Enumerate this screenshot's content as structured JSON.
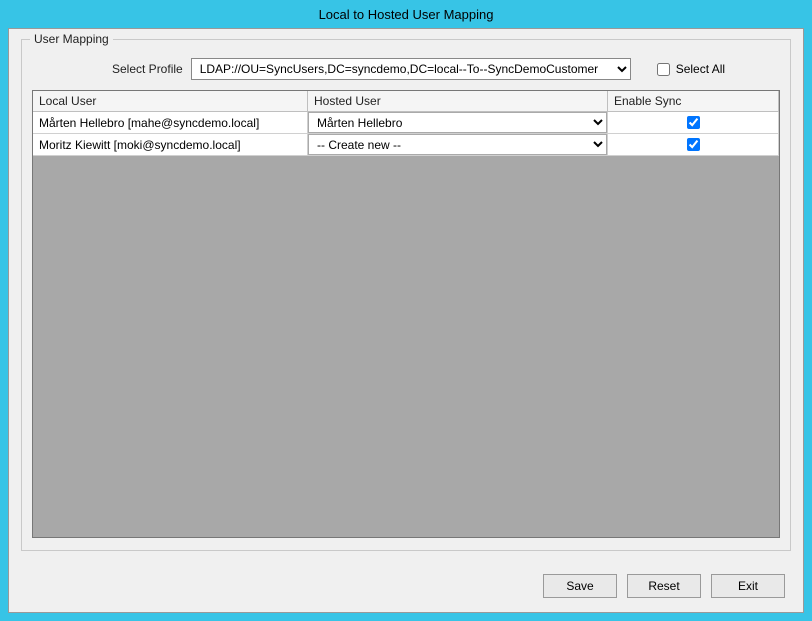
{
  "window": {
    "title": "Local to Hosted User Mapping"
  },
  "group": {
    "label": "User Mapping"
  },
  "profile": {
    "label": "Select Profile",
    "value": "LDAP://OU=SyncUsers,DC=syncdemo,DC=local--To--SyncDemoCustomer"
  },
  "selectAll": {
    "label": "Select All",
    "checked": false
  },
  "columns": {
    "local": "Local User",
    "hosted": "Hosted User",
    "enable": "Enable Sync"
  },
  "rows": [
    {
      "local": "Mårten Hellebro [mahe@syncdemo.local]",
      "hosted": "Mårten Hellebro",
      "enable": true
    },
    {
      "local": "Moritz Kiewitt [moki@syncdemo.local]",
      "hosted": "-- Create new --",
      "enable": true
    }
  ],
  "buttons": {
    "save": "Save",
    "reset": "Reset",
    "exit": "Exit"
  }
}
